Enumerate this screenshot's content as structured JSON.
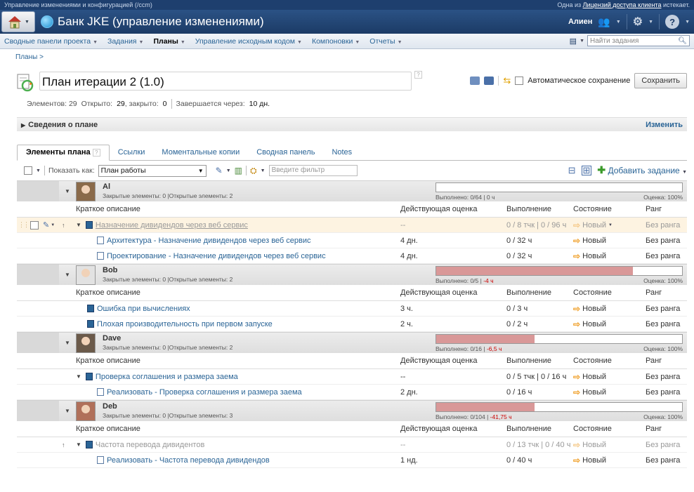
{
  "topstrip": {
    "left": "Управление изменениями и конфигурацией (/ccm)",
    "right_prefix": "Одна из",
    "right_link": "Лицензий доступа клиента",
    "right_suffix": "истекает."
  },
  "banner": {
    "title": "Банк JKE (управление изменениями)",
    "user": "Алиен"
  },
  "nav": {
    "items": [
      "Сводные панели проекта",
      "Задания",
      "Планы",
      "Управление исходным кодом",
      "Компоновки",
      "Отчеты"
    ],
    "active": 2,
    "search_placeholder": "Найти задания"
  },
  "breadcrumb": "Планы >",
  "plan": {
    "title": "План итерации 2 (1.0)",
    "autosave_label": "Автоматическое сохранение",
    "save_label": "Сохранить",
    "stats_items": "Элементов: 29",
    "stats_open_label": "Открыто:",
    "stats_open": "29",
    "stats_closed_label": ", закрыто:",
    "stats_closed": "0",
    "stats_ends_label": "Завершается через:",
    "stats_ends": "10 дн.",
    "details_label": "Сведения о плане",
    "edit_label": "Изменить"
  },
  "tabs": [
    "Элементы плана",
    "Ссылки",
    "Моментальные копии",
    "Сводная панель",
    "Notes"
  ],
  "toolbar": {
    "show_as_label": "Показать как:",
    "view_value": "План работы",
    "filter_placeholder": "Введите фильтр",
    "add_task_label": "Добавить задание"
  },
  "columns": {
    "summary": "Краткое описание",
    "estimate": "Действующая оценка",
    "progress": "Выполнение",
    "state": "Состояние",
    "rank": "Ранг"
  },
  "groups": [
    {
      "name": "Al",
      "sub": "Закрытые элементы: 0 |Открытые элементы: 2",
      "progress_fraction": 0,
      "progress_text": "Выполнено: 0/64 | 0 ч",
      "progress_neg": "",
      "estimate": "Оценка: 100%",
      "avatar_bg": "#8a6a4a",
      "rows": [
        {
          "summary": "Назначение дивидендов через веб сервис",
          "estimate": "--",
          "progress": "0 / 8 тчк | 0 / 96 ч",
          "state": "Новый",
          "rank": "Без ранга",
          "kind": "story",
          "highlight": true,
          "grey": true,
          "indent": 0
        },
        {
          "summary": "Архитектура - Назначение дивидендов через веб сервис",
          "estimate": "4 дн.",
          "progress": "0 / 32 ч",
          "state": "Новый",
          "rank": "Без ранга",
          "kind": "task",
          "highlight": false,
          "grey": false,
          "indent": 1
        },
        {
          "summary": "Проектирование - Назначение дивидендов через веб сервис",
          "estimate": "4 дн.",
          "progress": "0 / 32 ч",
          "state": "Новый",
          "rank": "Без ранга",
          "kind": "task",
          "highlight": false,
          "grey": false,
          "indent": 1
        }
      ]
    },
    {
      "name": "Bob",
      "sub": "Закрытые элементы: 0 |Открытые элементы: 2",
      "progress_fraction": 0.8,
      "progress_text": "Выполнено: 0/5 | ",
      "progress_neg": "-4 ч",
      "estimate": "Оценка: 100%",
      "avatar_bg": "#e2e2e2",
      "rows": [
        {
          "summary": "Ошибка при вычислениях",
          "estimate": "3 ч.",
          "progress": "0 / 3 ч",
          "state": "Новый",
          "rank": "Без ранга",
          "kind": "defect",
          "highlight": false,
          "grey": false,
          "indent": 0
        },
        {
          "summary": "Плохая производительность при первом запуске",
          "estimate": "2 ч.",
          "progress": "0 / 2 ч",
          "state": "Новый",
          "rank": "Без ранга",
          "kind": "defect",
          "highlight": false,
          "grey": false,
          "indent": 0
        }
      ]
    },
    {
      "name": "Dave",
      "sub": "Закрытые элементы: 0 |Открытые элементы: 2",
      "progress_fraction": 0.4,
      "progress_text": "Выполнено: 0/16 | ",
      "progress_neg": "-6,5 ч",
      "estimate": "Оценка: 100%",
      "avatar_bg": "#6b5a4a",
      "rows": [
        {
          "summary": "Проверка соглашения и размера заема",
          "estimate": "--",
          "progress": "0 / 5 тчк | 0 / 16 ч",
          "state": "Новый",
          "rank": "Без ранга",
          "kind": "story",
          "highlight": false,
          "grey": false,
          "indent": 0
        },
        {
          "summary": "Реализовать - Проверка соглашения и размера заема",
          "estimate": "2 дн.",
          "progress": "0 / 16 ч",
          "state": "Новый",
          "rank": "Без ранга",
          "kind": "task",
          "highlight": false,
          "grey": false,
          "indent": 1
        }
      ]
    },
    {
      "name": "Deb",
      "sub": "Закрытые элементы: 0 |Открытые элементы: 3",
      "progress_fraction": 0.4,
      "progress_text": "Выполнено: 0/104 | ",
      "progress_neg": "-41,75 ч",
      "estimate": "Оценка: 100%",
      "avatar_bg": "#b0705a",
      "rows": [
        {
          "summary": "Частота перевода дивидентов",
          "estimate": "--",
          "progress": "0 / 13 тчк | 0 / 40 ч",
          "state": "Новый",
          "rank": "Без ранга",
          "kind": "story",
          "highlight": false,
          "grey": true,
          "indent": 0
        },
        {
          "summary": "Реализовать - Частота перевода дивидендов",
          "estimate": "1 нд.",
          "progress": "0 / 40 ч",
          "state": "Новый",
          "rank": "Без ранга",
          "kind": "task",
          "highlight": false,
          "grey": false,
          "indent": 1
        }
      ]
    }
  ]
}
